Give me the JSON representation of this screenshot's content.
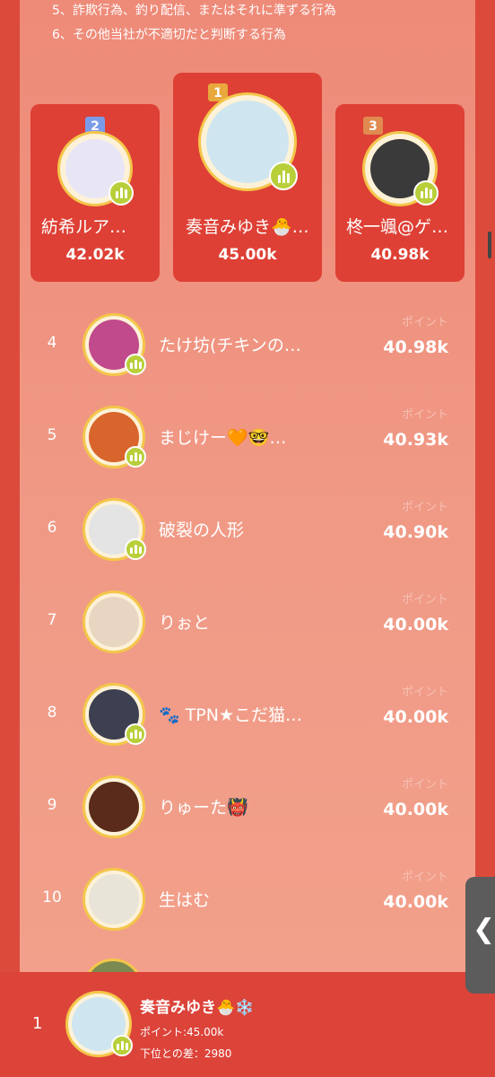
{
  "rules": {
    "rule5": "5、詐欺行為、釣り配信、またはそれに準ずる行為",
    "rule6": "6、その他当社が不適切だと判断する行為"
  },
  "top3": [
    {
      "rank": "2",
      "name": "紡希ルア…",
      "score": "42.02k",
      "face": "#e8e6f4"
    },
    {
      "rank": "1",
      "name": "奏音みゆき🐣…",
      "score": "45.00k",
      "face": "#cfe6f0"
    },
    {
      "rank": "3",
      "name": "柊一颯@ゲ…",
      "score": "40.98k",
      "face": "#3a3a3a"
    }
  ],
  "list": {
    "point_label": "ポイント",
    "rows": [
      {
        "rank": "4",
        "name": "たけ坊(チキンの…",
        "points": "40.98k",
        "face": "#c04a8c"
      },
      {
        "rank": "5",
        "name": "まじけー🧡🤓…",
        "points": "40.93k",
        "face": "#d8652c"
      },
      {
        "rank": "6",
        "name": "破裂の人形",
        "points": "40.90k",
        "face": "#e4e4e4"
      },
      {
        "rank": "7",
        "name": "りぉと",
        "points": "40.00k",
        "face": "#e9d6c2"
      },
      {
        "rank": "8",
        "name": "🐾 TPN★こだ猫…",
        "points": "40.00k",
        "face": "#3c4050"
      },
      {
        "rank": "9",
        "name": "りゅーた👹",
        "points": "40.00k",
        "face": "#5a2b1a"
      },
      {
        "rank": "10",
        "name": "生はむ",
        "points": "40.00k",
        "face": "#e9e4d8"
      }
    ]
  },
  "footer": {
    "rank": "1",
    "name": "奏音みゆき🐣❄️",
    "points": "ポイント:45.00k",
    "diff": "下位との差：2980"
  },
  "side_tab_icon": "chevron-left-icon",
  "colors": {
    "accent": "#dc4a3c",
    "badge": "#b9cf3a",
    "ring": "#f4c64a"
  }
}
